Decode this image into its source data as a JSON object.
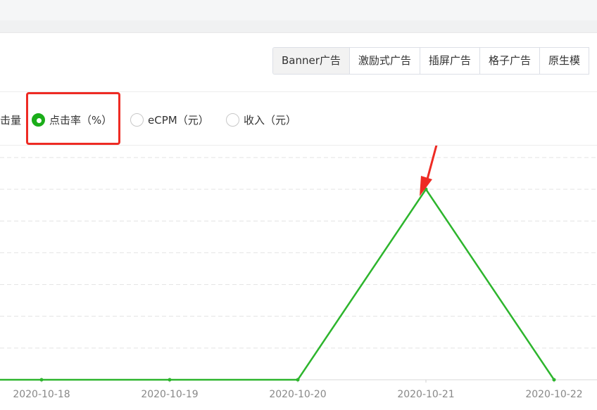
{
  "tabs": [
    {
      "label": "Banner广告",
      "active": true
    },
    {
      "label": "激励式广告",
      "active": false
    },
    {
      "label": "插屏广告",
      "active": false
    },
    {
      "label": "格子广告",
      "active": false
    },
    {
      "label": "原生模",
      "active": false
    }
  ],
  "metric_options": {
    "partial_label": "击量",
    "options": [
      {
        "label": "点击率（%）",
        "checked": true
      },
      {
        "label": "eCPM（元）",
        "checked": false
      },
      {
        "label": "收入（元）",
        "checked": false
      }
    ]
  },
  "colors": {
    "accent": "#1aad19",
    "line": "#2db52d",
    "annotation": "#ee2b24"
  },
  "chart_data": {
    "type": "line",
    "title": "",
    "xlabel": "",
    "ylabel": "",
    "categories": [
      "2020-10-18",
      "2020-10-19",
      "2020-10-20",
      "2020-10-21",
      "2020-10-22"
    ],
    "series": [
      {
        "values": [
          0,
          0,
          0,
          6,
          0
        ]
      }
    ],
    "ylim": [
      0,
      7
    ],
    "grid": true
  }
}
